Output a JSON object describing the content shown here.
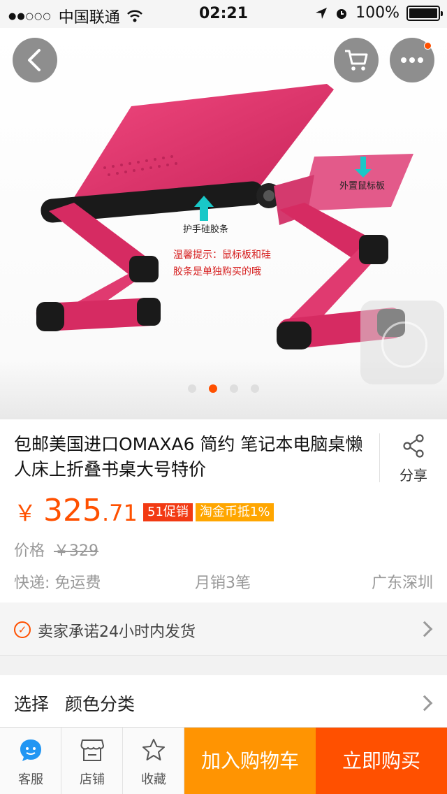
{
  "status_bar": {
    "carrier": "中国联通",
    "time": "02:21",
    "battery": "100%"
  },
  "gallery": {
    "annotations": {
      "mouse_pad": "外置鼠标板",
      "wrist_strip": "护手硅胶条",
      "tip_line1": "温馨提示：鼠标板和硅",
      "tip_line2": "胶条是单独购买的哦"
    },
    "page_count": 4,
    "active_page": 2
  },
  "product": {
    "title": "包邮美国进口OMAXA6 简约 笔记本电脑桌懒人床上折叠书桌大号特价",
    "share_label": "分享",
    "currency": "￥",
    "price_int": "325",
    "price_dec": ".71",
    "tags": [
      "51促销",
      "淘金币抵1%"
    ],
    "orig_price_label": "价格",
    "orig_price": "￥329",
    "shipping": "快递: 免运费",
    "monthly_sales": "月销3笔",
    "location": "广东深圳"
  },
  "promise": {
    "text": "卖家承诺24小时内发货"
  },
  "select": {
    "label": "选择",
    "value": "颜色分类"
  },
  "bottom_bar": {
    "service": "客服",
    "store": "店铺",
    "favorite": "收藏",
    "add_to_cart": "加入购物车",
    "buy_now": "立即购买"
  },
  "colors": {
    "accent": "#ff5000",
    "cart_button": "#ff9402",
    "product": "#e0306a"
  }
}
